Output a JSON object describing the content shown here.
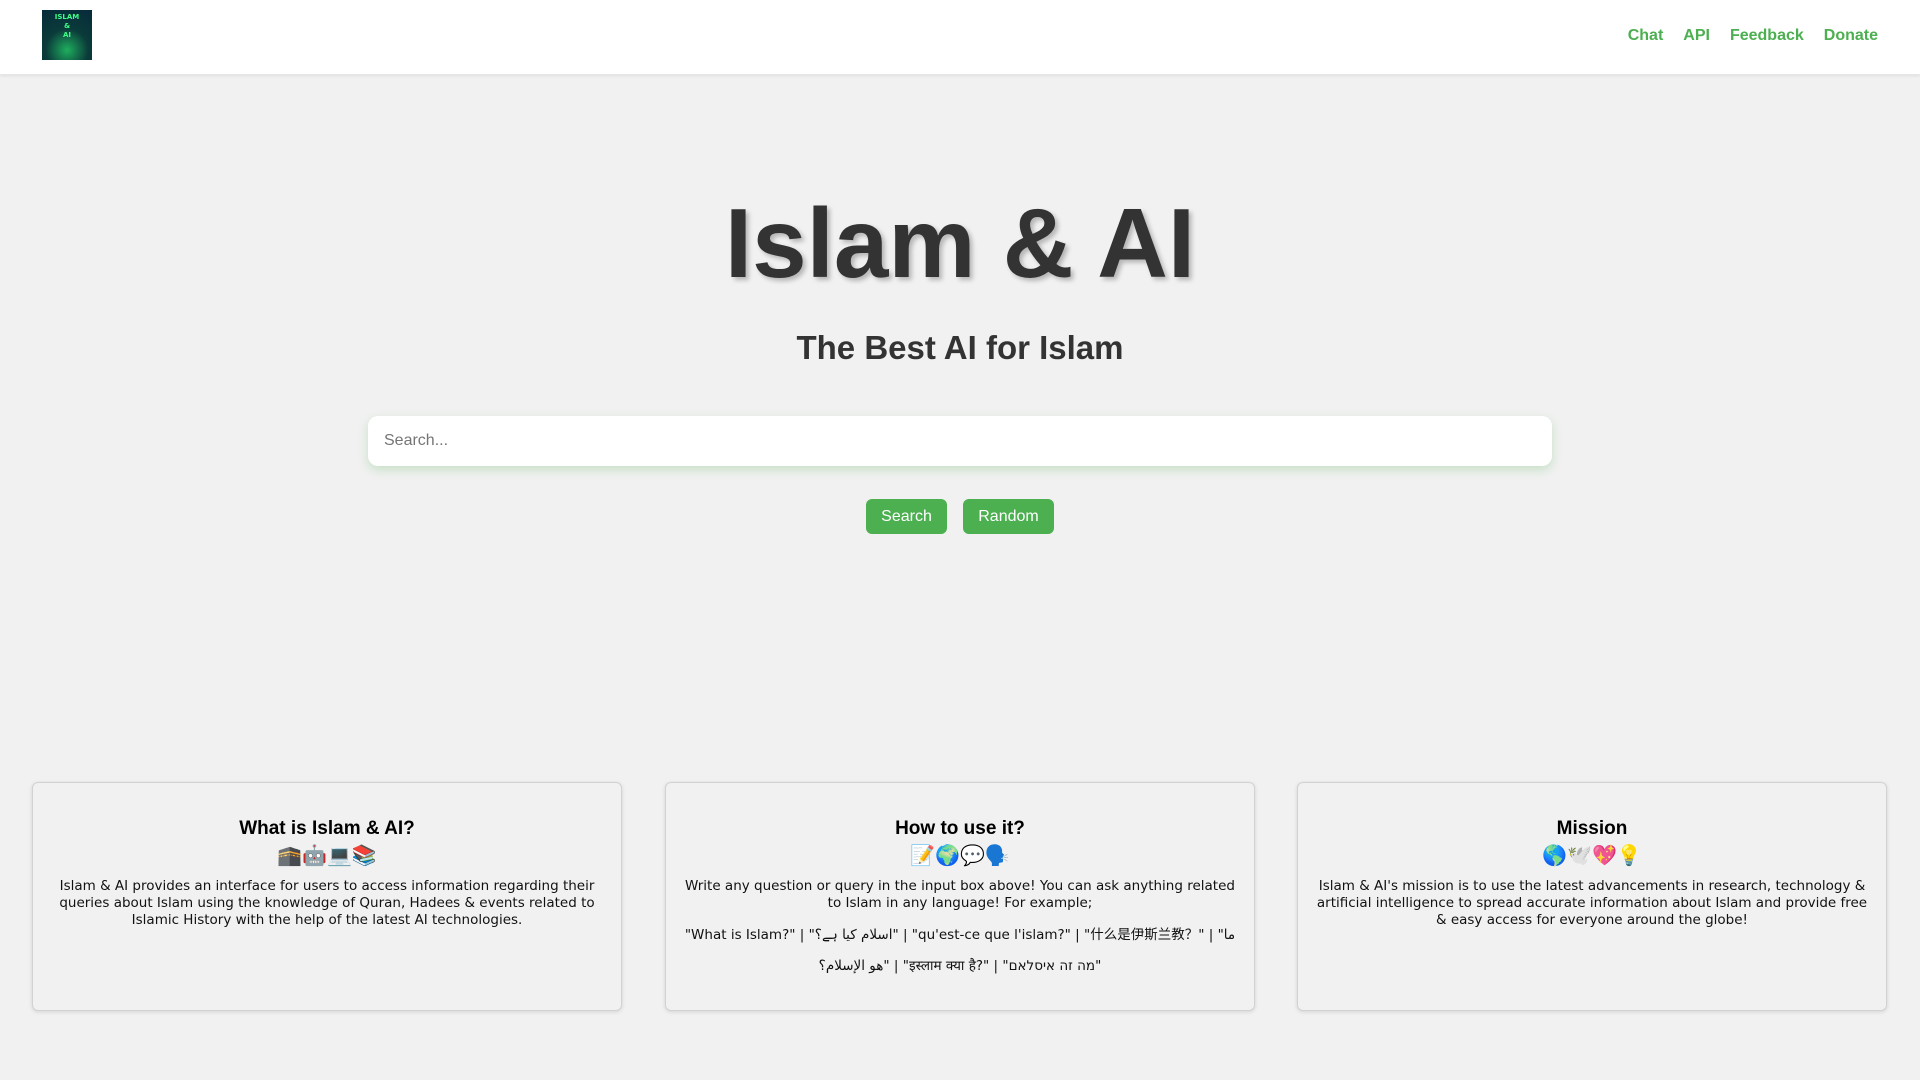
{
  "logo": {
    "lines": [
      "ISLAM",
      "&",
      "AI"
    ]
  },
  "nav": {
    "chat": "Chat",
    "api": "API",
    "feedback": "Feedback",
    "donate": "Donate"
  },
  "hero": {
    "title": "Islam & AI",
    "subtitle": "The Best AI for Islam"
  },
  "search": {
    "placeholder": "Search...",
    "value": ""
  },
  "buttons": {
    "search": "Search",
    "random": "Random"
  },
  "cards": [
    {
      "title": "What is Islam & AI?",
      "emoji": "🕋🤖💻📚",
      "text": "Islam & AI provides an interface for users to access information regarding their queries about Islam using the knowledge of Quran, Hadees & events related to Islamic History with the help of the latest AI technologies."
    },
    {
      "title": "How to use it?",
      "emoji": "📝🌍💬🗣️",
      "text": "Write any question or query in the input box above! You can ask anything related to Islam in any language! For example;",
      "examples": "\"What is Islam?\" | \"اسلام کیا ہے؟\" | \"qu'est-ce que l'islam?\" | \"什么是伊斯兰教？\" | \"ما هو الإسلام؟\" | \"इस्लाम क्या है?\" | \"מה זה איסלאם\""
    },
    {
      "title": "Mission",
      "emoji": "🌎🕊️💖💡",
      "text": "Islam & AI's mission is to use the latest advancements in research, technology & artificial intelligence to spread accurate information about Islam and provide free & easy access for everyone around the globe!"
    }
  ],
  "colors": {
    "accent": "#4caf50",
    "background": "#f1f1f1",
    "text": "#333333"
  }
}
